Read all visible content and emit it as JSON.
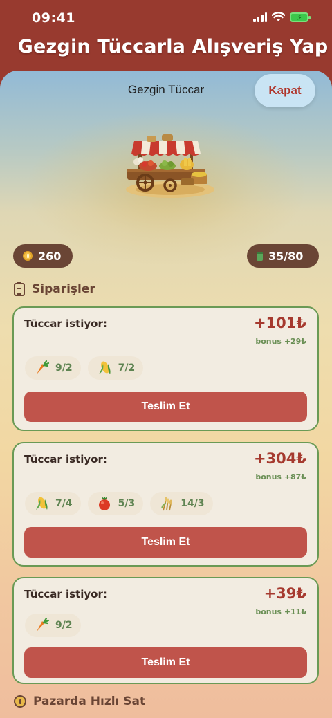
{
  "status": {
    "time": "09:41"
  },
  "app": {
    "title": "Gezgin Tüccarla Alışveriş Yap"
  },
  "sheet": {
    "title": "Gezgin Tüccar",
    "close_label": "Kapat"
  },
  "stats": {
    "coins": "260",
    "capacity": "35/80"
  },
  "sections": {
    "orders": "Siparişler",
    "quick_sell": "Pazarda Hızlı Sat"
  },
  "orders": [
    {
      "requester_label": "Tüccar istiyor:",
      "reward": "+101₺",
      "bonus": "bonus +29₺",
      "items": [
        {
          "icon": "carrot-icon",
          "count": "9/2"
        },
        {
          "icon": "corn-icon",
          "count": "7/2"
        }
      ],
      "button": "Teslim Et"
    },
    {
      "requester_label": "Tüccar istiyor:",
      "reward": "+304₺",
      "bonus": "bonus +87₺",
      "items": [
        {
          "icon": "corn-icon",
          "count": "7/4"
        },
        {
          "icon": "tomato-icon",
          "count": "5/3"
        },
        {
          "icon": "wheat-icon",
          "count": "14/3"
        }
      ],
      "button": "Teslim Et"
    },
    {
      "requester_label": "Tüccar istiyor:",
      "reward": "+39₺",
      "bonus": "bonus +11₺",
      "items": [
        {
          "icon": "carrot-icon",
          "count": "9/2"
        }
      ],
      "button": "Teslim Et"
    }
  ],
  "colors": {
    "header": "#983a2f",
    "accent": "#c0544b",
    "order_border": "#6a9a55",
    "pill": "#6a4535"
  }
}
